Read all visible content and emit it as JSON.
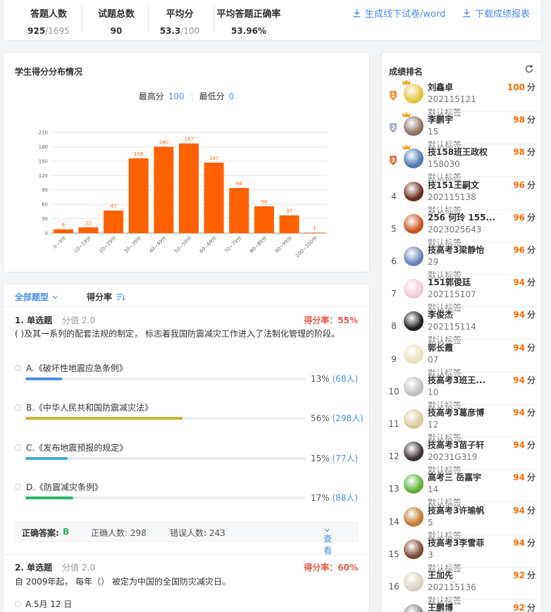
{
  "stats": {
    "answer_count_label": "答题人数",
    "answer_count": "925",
    "answer_total": "/1695",
    "questions_label": "试题总数",
    "questions": "90",
    "average_label": "平均分",
    "average": "53.3",
    "average_total": "/100",
    "accuracy_label": "平均答题正确率",
    "accuracy": "53.96%",
    "gen_offline_label": "生成线下试卷/word",
    "download_report_label": "下载成绩报表"
  },
  "distribution": {
    "title": "学生得分分布情况",
    "max_label": "最高分",
    "max_value": "100",
    "min_label": "最低分",
    "min_value": "0"
  },
  "chart_data": {
    "type": "bar",
    "title": "",
    "xlabel": "",
    "ylabel": "",
    "categories": [
      "0~9分",
      "10~19分",
      "20~29分",
      "30~39分",
      "40~49分",
      "50~59分",
      "60~69分",
      "70~79分",
      "80~89分",
      "90~99分",
      "100~100分"
    ],
    "values": [
      8,
      12,
      47,
      156,
      180,
      187,
      147,
      94,
      56,
      37,
      1
    ],
    "ylim": [
      0,
      210
    ],
    "yticks": [
      0,
      30,
      60,
      90,
      120,
      150,
      180,
      210
    ],
    "grid": true,
    "bar_color": "#ff6000",
    "label_color": "#ff6000"
  },
  "questions_panel": {
    "filter_label": "全部题型",
    "sort_label": "得分率",
    "q1": {
      "number": "1. 单选题",
      "score": "分值 2.0",
      "rate": "得分率：55%",
      "text": "( )及其一系列的配套法规的制定， 标志着我国防震减灾工作进入了法制化管理的阶段。",
      "options": [
        {
          "label": "A.《破坏性地震应急条例》",
          "pct": "13%",
          "count": "(68人)",
          "ratio": 0.13,
          "color": "#4a8ee6"
        },
        {
          "label": "B.《中华人民共和国防震减灾法》",
          "pct": "56%",
          "count": "(298人)",
          "ratio": 0.56,
          "color": "#c9b52e"
        },
        {
          "label": "C.《发布地震预报的规定》",
          "pct": "15%",
          "count": "(77人)",
          "ratio": 0.15,
          "color": "#3ba8dc"
        },
        {
          "label": "D.《防震减灾条例》",
          "pct": "17%",
          "count": "(88人)",
          "ratio": 0.17,
          "color": "#2db46a"
        }
      ],
      "answer_label": "正确答案:",
      "answer": "B",
      "correct_count": "正确人数: 298",
      "wrong_count": "错误人数: 243",
      "view_label": "查看"
    },
    "q2": {
      "number": "2. 单选题",
      "score": "分值 2.0",
      "rate": "得分率：60%",
      "text": "自 2009年起， 每年（） 被定为中国的全国防灾减灾日。",
      "option_a": "A.5月 12 日"
    }
  },
  "ranking": {
    "title": "成绩排名",
    "unit": "分",
    "items": [
      {
        "rank": "1",
        "name": "刘鑫卓",
        "id": "202115121",
        "tag": "默认标签",
        "score": "100",
        "avatar": "#e6c23a"
      },
      {
        "rank": "2",
        "name": "李鹏宇",
        "id": "15",
        "tag": "默认标签",
        "score": "98",
        "avatar": "#8a7060"
      },
      {
        "rank": "3",
        "name": "技158班王政权",
        "id": "158030",
        "tag": "默认标签",
        "score": "98",
        "avatar": "#4a78b0"
      },
      {
        "rank": "4",
        "name": "技151王嗣文",
        "id": "202115138",
        "tag": "默认标签",
        "score": "96",
        "avatar": "#6a2a1e"
      },
      {
        "rank": "5",
        "name": "256 何玲 155...",
        "id": "2023025643",
        "tag": "默认标签",
        "score": "96",
        "avatar": "#c8501e"
      },
      {
        "rank": "6",
        "name": "技高考3梁静怡",
        "id": "29",
        "tag": "默认标签",
        "score": "96",
        "avatar": "#6a80b8"
      },
      {
        "rank": "7",
        "name": "151郭俊廷",
        "id": "202115107",
        "tag": "默认标签",
        "score": "94",
        "avatar": "#f0c8d8"
      },
      {
        "rank": "8",
        "name": "李俊杰",
        "id": "202115114",
        "tag": "默认标签",
        "score": "94",
        "avatar": "#1e1e1e"
      },
      {
        "rank": "9",
        "name": "郭长霞",
        "id": "07",
        "tag": "默认标签",
        "score": "94",
        "avatar": "#e8e0c0"
      },
      {
        "rank": "10",
        "name": "技高考3班王...",
        "id": "10",
        "tag": "默认标签",
        "score": "94",
        "avatar": "#c0c0c0"
      },
      {
        "rank": "11",
        "name": "技高考3葛彦博",
        "id": "12",
        "tag": "默认标签",
        "score": "94",
        "avatar": "#d8c8a0"
      },
      {
        "rank": "12",
        "name": "技高考3苗子轩",
        "id": "20231G319",
        "tag": "默认标签",
        "score": "94",
        "avatar": "#3a3030"
      },
      {
        "rank": "13",
        "name": "高考三 岳嘉宇",
        "id": "14",
        "tag": "默认标签",
        "score": "94",
        "avatar": "#5ab030"
      },
      {
        "rank": "14",
        "name": "技高考3许瑜帆",
        "id": "5",
        "tag": "默认标签",
        "score": "94",
        "avatar": "#c07830"
      },
      {
        "rank": "15",
        "name": "技高考3李雪菲",
        "id": "3",
        "tag": "默认标签",
        "score": "94",
        "avatar": "#7a4830"
      },
      {
        "rank": "16",
        "name": "王加先",
        "id": "202115136",
        "tag": "默认标签",
        "score": "92",
        "avatar": "#d8d0c0"
      },
      {
        "rank": "17",
        "name": "王鹏博",
        "id": "",
        "tag": "",
        "score": "92",
        "avatar": "#888888"
      }
    ]
  }
}
